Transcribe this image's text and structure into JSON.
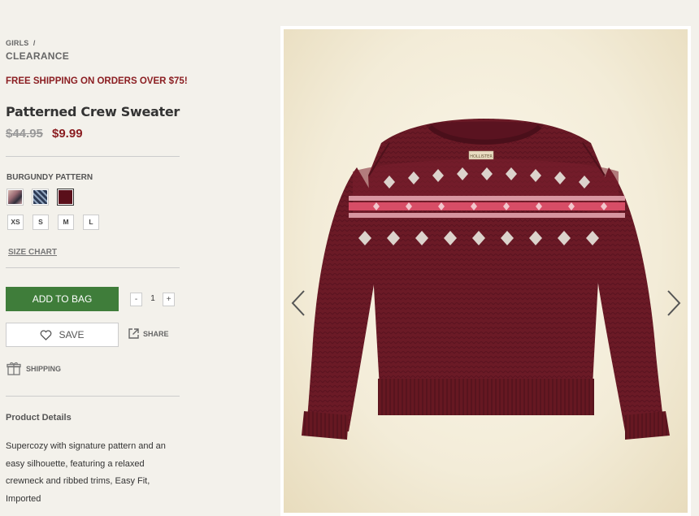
{
  "breadcrumb": {
    "parent": "GIRLS",
    "separator": "/",
    "current": "CLEARANCE"
  },
  "promo": "FREE SHIPPING ON ORDERS OVER $75!",
  "product": {
    "title": "Patterned Crew Sweater",
    "price_old": "$44.95",
    "price_new": "$9.99",
    "color_label": "BURGUNDY PATTERN",
    "swatches": [
      {
        "name": "pink-print",
        "color": "#b88f96"
      },
      {
        "name": "navy-pattern",
        "color": "#3b4a66"
      },
      {
        "name": "burgundy-pattern",
        "color": "#5a0f1a",
        "selected": true
      }
    ],
    "sizes": [
      "XS",
      "S",
      "M",
      "L"
    ],
    "size_chart": "SIZE CHART",
    "add_to_bag": "ADD TO BAG",
    "qty_minus": "-",
    "qty_value": "1",
    "qty_plus": "+",
    "save": "SAVE",
    "share": "SHARE",
    "shipping": "SHIPPING",
    "details_heading": "Product Details",
    "details_text": "Supercozy with signature pattern and an easy silhouette, featuring a relaxed crewneck and ribbed trims, Easy Fit, Imported"
  },
  "image": {
    "label_tag": "HOLLISTER",
    "prev_icon": "chevron-left-icon",
    "next_icon": "chevron-right-icon"
  },
  "colors": {
    "accent_red": "#8b1e22",
    "button_green": "#3f7d3a",
    "sweater": "#6b1a26"
  }
}
